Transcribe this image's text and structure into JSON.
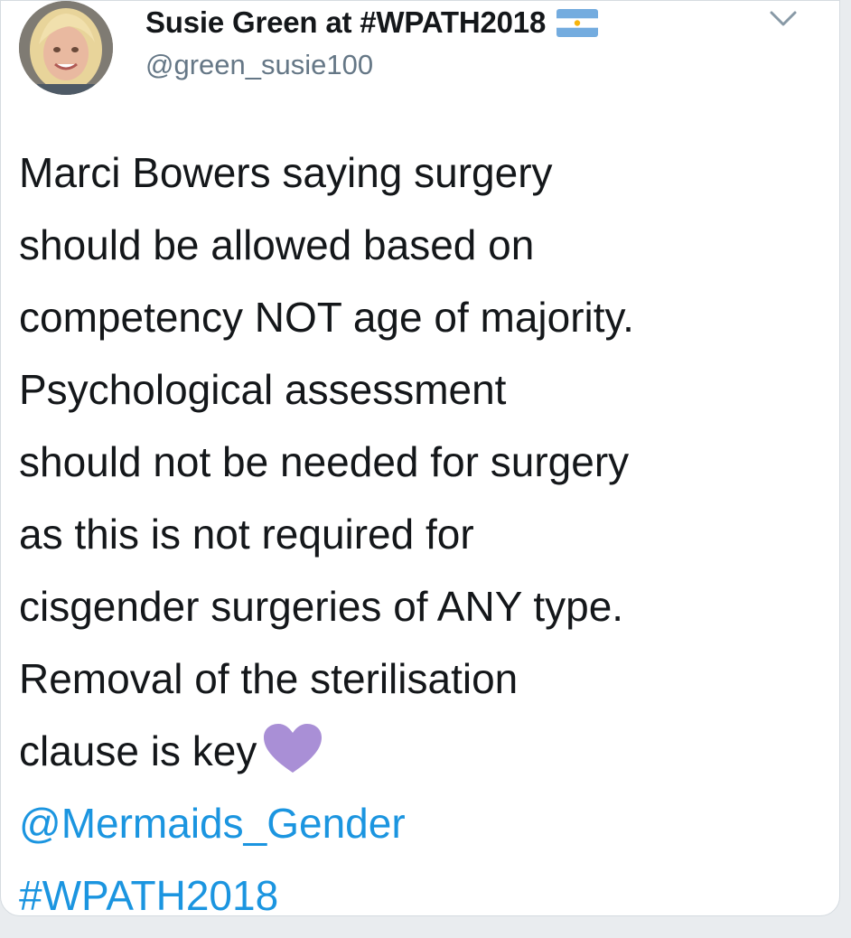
{
  "tweet": {
    "display_name": "Susie Green at #WPATH2018",
    "name_emoji": "argentina-flag-icon",
    "handle": "@green_susie100",
    "text_lines": [
      "Marci Bowers saying surgery",
      "should be allowed based on",
      "competency NOT age of majority.",
      "Psychological assessment",
      "should not be needed for surgery",
      "as this is not required for",
      "cisgender surgeries of ANY type.",
      "Removal of the sterilisation",
      "clause is key"
    ],
    "emoji_after_text": "purple-heart-icon",
    "mention": "@Mermaids_Gender",
    "hashtag": "#WPATH2018"
  },
  "colors": {
    "text": "#14171a",
    "muted": "#657786",
    "link": "#1b95e0",
    "heart": "#a98fd6",
    "background": "#e9ecef",
    "card": "#ffffff"
  },
  "icons": {
    "menu": "chevron-down-icon",
    "avatar": "profile-photo"
  }
}
